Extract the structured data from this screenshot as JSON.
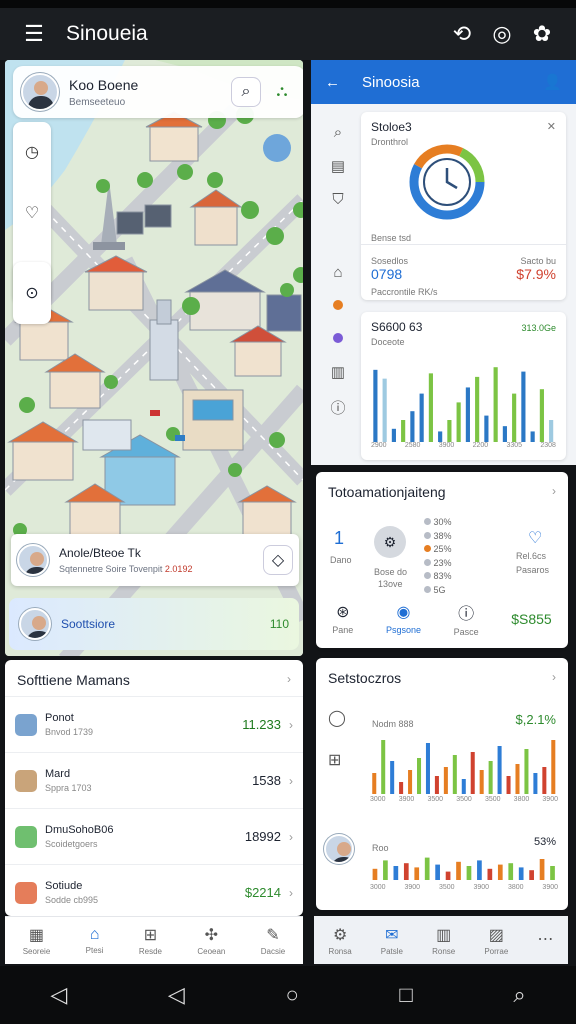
{
  "app": {
    "title": "Sinoueia"
  },
  "left_panel": {
    "profile": {
      "name": "Koo Boene",
      "subtitle": "Bemseeteuo"
    },
    "info_card": {
      "name": "Anole/Bteoe Tk",
      "subtitle": "Sqtennetre Soire Tovenpit",
      "value": "2.0192"
    },
    "highlight": {
      "label": "Soottsiore",
      "value": "110"
    }
  },
  "right_panel": {
    "header_title": "Sinoosia",
    "clock_card": {
      "title": "Stoloe3",
      "subtitle": "Dronthrol",
      "mid_label": "Bense tsd",
      "left_label": "Sosedlos",
      "left_value": "0798",
      "right_label": "Sacto bu",
      "right_value": "$7.9%",
      "footer": "Paccrontile RK/s"
    },
    "bar_card": {
      "title": "S6600 63",
      "subtitle": "Doceote",
      "value": "313.0Ge",
      "ticks": [
        "2900",
        "2580",
        "3900",
        "2200",
        "3305",
        "2308"
      ]
    },
    "bar_card_values": [
      0.82,
      0.72,
      0.15,
      0.25,
      0.35,
      0.55,
      0.78,
      0.12,
      0.25,
      0.45,
      0.62,
      0.74,
      0.3,
      0.85,
      0.18,
      0.55,
      0.8,
      0.12,
      0.6,
      0.25
    ],
    "bar_card_colors": [
      "#2b78c5",
      "#9ecae1",
      "#2b78c5",
      "#7cc444",
      "#2b78c5",
      "#2b78c5",
      "#7cc444",
      "#2b78c5",
      "#7cc444",
      "#7cc444",
      "#2b78c5",
      "#7cc444",
      "#2b78c5",
      "#7cc444",
      "#2b78c5",
      "#7cc444",
      "#2b78c5",
      "#2b78c5",
      "#7cc444",
      "#9ecae1"
    ]
  },
  "tour_card": {
    "title": "Totoamationjaiteng",
    "big_number": "1",
    "big_label": "Dano",
    "mid_label": "Bose do",
    "mid_sub": "13ove",
    "stats": [
      "30%",
      "38%",
      "25%",
      "23%",
      "83%",
      "5G"
    ],
    "heart_label": "Rel.6cs",
    "heart_label2": "Pasaros",
    "bottom": [
      {
        "label": "Pane"
      },
      {
        "label": "Psgsone"
      },
      {
        "label": "Pasce"
      }
    ],
    "value": "$S855"
  },
  "settings_list": {
    "title": "Softtiene Mamans",
    "items": [
      {
        "name": "Ponot",
        "sub": "Bnvod 1739",
        "value": "11.233",
        "color": "#1f7a1f"
      },
      {
        "name": "Mard",
        "sub": "Sppra 1703",
        "value": "1538",
        "color": "#1d2330"
      },
      {
        "name": "DmuSohoB06",
        "sub": "Scoidetgoers",
        "value": "18992",
        "color": "#1d2330"
      },
      {
        "name": "Sotiude",
        "sub": "Sodde cb995",
        "value": "$2214",
        "color": "#2e8b2e"
      }
    ]
  },
  "stats_card": {
    "title": "Setstoczros",
    "row1": {
      "label": "Nodm 888",
      "value": "$,2.1%",
      "ticks": [
        "3000",
        "3900",
        "3500",
        "3500",
        "3500",
        "3800",
        "3900"
      ]
    },
    "row2": {
      "label": "Roo",
      "value": "53%",
      "ticks": [
        "3000",
        "3900",
        "3500",
        "3900",
        "3800",
        "3900"
      ]
    },
    "row1_values": [
      0.35,
      0.9,
      0.55,
      0.2,
      0.4,
      0.6,
      0.85,
      0.3,
      0.45,
      0.65,
      0.25,
      0.7,
      0.4,
      0.55,
      0.8,
      0.3,
      0.5,
      0.75,
      0.35,
      0.45,
      0.9
    ],
    "row2_values": [
      0.4,
      0.7,
      0.5,
      0.6,
      0.45,
      0.8,
      0.55,
      0.3,
      0.65,
      0.5,
      0.7,
      0.4,
      0.55,
      0.6,
      0.45,
      0.35,
      0.75,
      0.5
    ]
  },
  "bottom_nav_left": [
    {
      "label": "Seoreie",
      "icon": "calendar-icon"
    },
    {
      "label": "Ptesi",
      "icon": "home-icon",
      "active": true
    },
    {
      "label": "Resde",
      "icon": "grid-icon"
    },
    {
      "label": "Ceoean",
      "icon": "puzzle-icon"
    },
    {
      "label": "Dacsie",
      "icon": "edit-icon"
    }
  ],
  "bottom_nav_right": [
    {
      "label": "Ronsa",
      "icon": "gear-icon"
    },
    {
      "label": "Patsle",
      "icon": "chat-icon",
      "active": true
    },
    {
      "label": "Ronse",
      "icon": "building-icon"
    },
    {
      "label": "Porrae",
      "icon": "image-icon"
    },
    {
      "label": "",
      "icon": "more-icon"
    }
  ]
}
